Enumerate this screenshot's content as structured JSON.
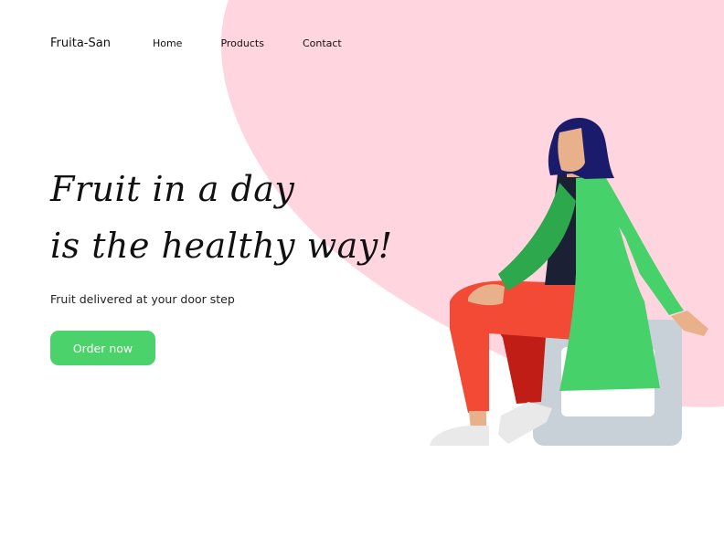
{
  "nav": {
    "brand": "Fruita-San",
    "links": [
      "Home",
      "Products",
      "Contact"
    ]
  },
  "hero": {
    "title_line1": "Fruit in a day",
    "title_line2": "is the healthy way!",
    "subtitle": "Fruit delivered at your door step",
    "cta_label": "Order now"
  },
  "colors": {
    "accent_green": "#4cd26b",
    "blob_pink": "#ffd6e0",
    "coat_green": "#46d16a",
    "pants_red": "#f24a34",
    "hair_navy": "#1b1b6b",
    "stool_gray": "#c9d1d8"
  },
  "illustration": {
    "icon": "woman-sitting-on-stool-illustration"
  }
}
